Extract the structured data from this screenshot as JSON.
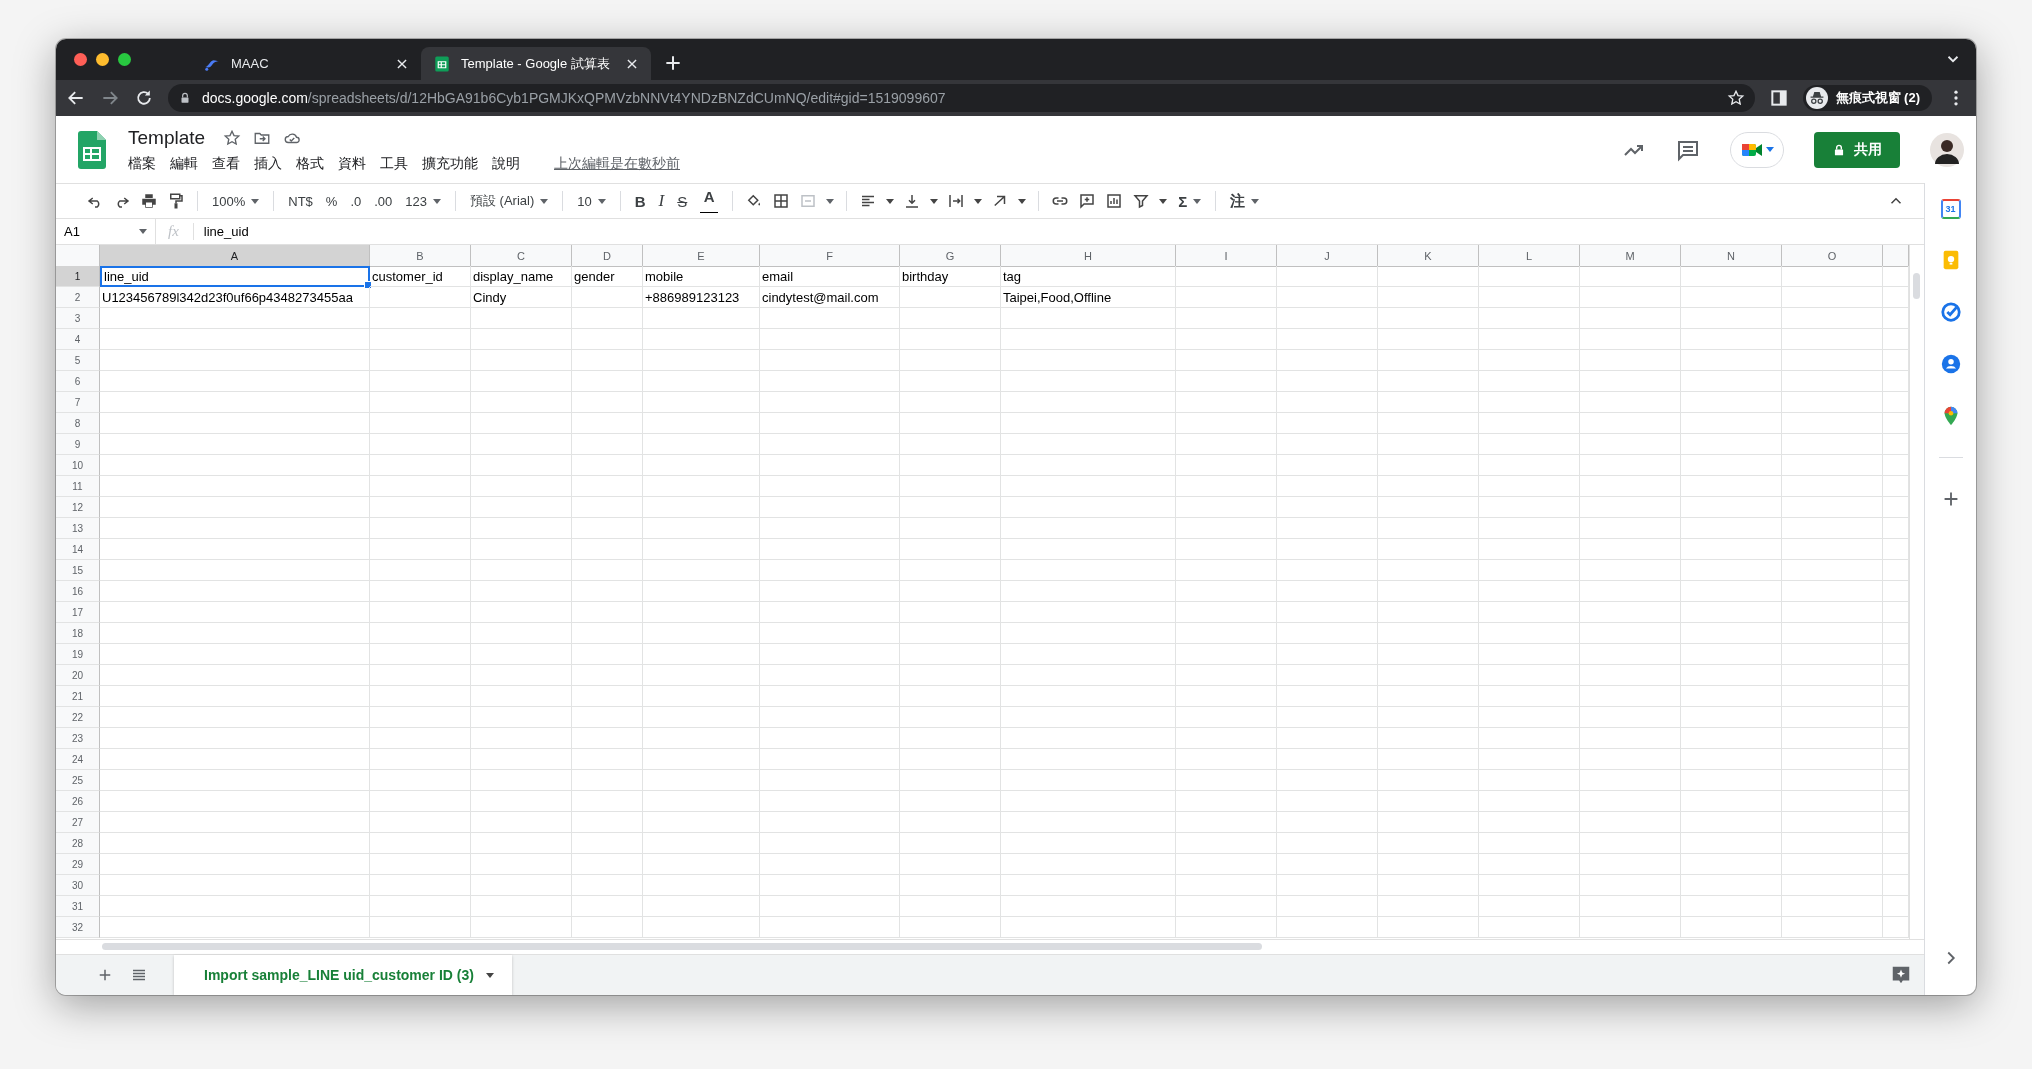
{
  "browser": {
    "tabs": [
      {
        "title": "MAAC",
        "selected": false
      },
      {
        "title": "Template - Google 試算表",
        "selected": true
      }
    ],
    "url": {
      "host": "docs.google.com",
      "path": "/spreadsheets/d/12HbGA91b6Cyb1PGMJKxQPMVzbNNVt4YNDzBNZdCUmNQ/edit#gid=1519099607"
    },
    "profile": "無痕式視窗 (2)"
  },
  "document": {
    "title": "Template",
    "menu": [
      "檔案",
      "編輯",
      "查看",
      "插入",
      "格式",
      "資料",
      "工具",
      "擴充功能",
      "說明"
    ],
    "last_edit": "上次編輯是在數秒前",
    "share": "共用"
  },
  "toolbar": {
    "zoom": "100%",
    "currency": "NT$",
    "percent": "%",
    "decrease_decimal": ".0",
    "increase_decimal": ".00",
    "number_format": "123",
    "font": "預設 (Arial)",
    "font_size": "10",
    "bold": "B",
    "italic": "I",
    "strikethrough": "S",
    "text_color": "A",
    "functions": "Σ",
    "input_tools": "注"
  },
  "formula_bar": {
    "name_box": "A1",
    "fx": "fx",
    "value": "line_uid"
  },
  "columns": [
    "A",
    "B",
    "C",
    "D",
    "E",
    "F",
    "G",
    "H",
    "I",
    "J",
    "K",
    "L",
    "M",
    "N",
    "O"
  ],
  "row_numbers": [
    "1",
    "2",
    "3",
    "4",
    "5",
    "6",
    "7",
    "8",
    "9",
    "10",
    "11",
    "12",
    "13",
    "14",
    "15",
    "16",
    "17",
    "18",
    "19",
    "20",
    "21",
    "22",
    "23",
    "24",
    "25",
    "26",
    "27",
    "28",
    "29",
    "30",
    "31",
    "32"
  ],
  "rows": [
    {
      "A": {
        "text": "line_uid",
        "selected": true
      },
      "B": {
        "text": "customer_id",
        "selected": false
      },
      "C": {
        "text": "display_name",
        "selected": false
      },
      "D": {
        "text": "gender",
        "selected": false
      },
      "E": {
        "text": "mobile",
        "selected": false
      },
      "F": {
        "text": "email",
        "selected": false
      },
      "G": {
        "text": "birthday",
        "selected": false
      },
      "H": {
        "text": "tag",
        "selected": false
      }
    },
    {
      "A": {
        "text": "U123456789l342d23f0uf66p4348273455aa",
        "selected": false
      },
      "C": {
        "text": "Cindy",
        "selected": false
      },
      "E": {
        "text": "+886989123123",
        "selected": false
      },
      "F": {
        "text": "cindytest@mail.com",
        "selected": false
      },
      "H": {
        "text": "Taipei,Food,Offline",
        "selected": false
      }
    }
  ],
  "sheet_tabs": [
    {
      "label": "Import sample_LINE uid_customer ID (3)",
      "selected": true
    }
  ],
  "side_panel": {
    "calendar_day": "31"
  }
}
